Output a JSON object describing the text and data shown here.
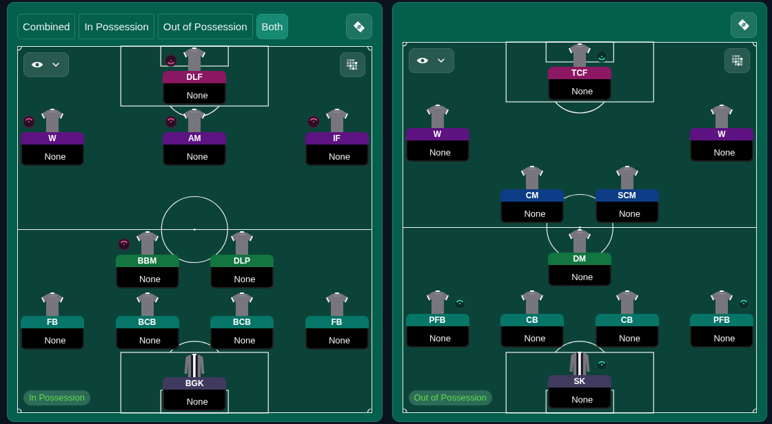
{
  "panels": [
    {
      "kind": "in_possession",
      "tabs": [
        {
          "label": "Combined",
          "selected": false
        },
        {
          "label": "In Possession",
          "selected": false
        },
        {
          "label": "Out of Possession",
          "selected": false
        },
        {
          "label": "Both",
          "selected": true
        }
      ],
      "pitch": {
        "halves": [
          {
            "lines": [
              {
                "centre": {
                  "role": "DLF",
                  "name": "None",
                  "color": "#8c1763",
                  "kind": "outfield",
                  "badge": {
                    "kind": "arc_bottom"
                  }
                }
              },
              {
                "left": {
                  "role": "W",
                  "name": "None",
                  "color": "#5e1382",
                  "kind": "outfield",
                  "badge": {
                    "kind": "arc_top"
                  }
                },
                "centre": {
                  "role": "AM",
                  "name": "None",
                  "color": "#5e1382",
                  "kind": "outfield",
                  "badge": {
                    "kind": "arc_top"
                  }
                },
                "right": {
                  "role": "IF",
                  "name": "None",
                  "color": "#5e1382",
                  "kind": "outfield",
                  "badge": {
                    "kind": "arc_top"
                  }
                }
              }
            ]
          },
          {
            "lines": [
              {
                "centre_left": {
                  "role": "BBM",
                  "name": "None",
                  "color": "#137540",
                  "kind": "outfield",
                  "badge": {
                    "kind": "arc_top"
                  }
                },
                "centre_right": {
                  "role": "DLP",
                  "name": "None",
                  "color": "#137540",
                  "kind": "outfield"
                }
              },
              {
                "left": {
                  "role": "FB",
                  "name": "None",
                  "color": "#077567",
                  "kind": "outfield"
                },
                "centre_left": {
                  "role": "BCB",
                  "name": "None",
                  "color": "#077567",
                  "kind": "outfield"
                },
                "centre_right": {
                  "role": "BCB",
                  "name": "None",
                  "color": "#077567",
                  "kind": "outfield"
                },
                "right": {
                  "role": "FB",
                  "name": "None",
                  "color": "#077567",
                  "kind": "outfield"
                }
              },
              {
                "centre": {
                  "role": "BGK",
                  "name": "None",
                  "color": "#403a5e",
                  "kind": "goalkeeper"
                }
              }
            ]
          }
        ],
        "label": "In Possession"
      }
    },
    {
      "kind": "out_of_possession",
      "pitch": {
        "halves": [
          {
            "lines": [
              {
                "centre": {
                  "role": "TCF",
                  "name": "None",
                  "color": "#8c1763",
                  "kind": "outfield",
                  "badge": {
                    "kind": "arc_bottom"
                  }
                }
              },
              {
                "left": {
                  "role": "W",
                  "name": "None",
                  "color": "#5e1382",
                  "kind": "outfield"
                },
                "right": {
                  "role": "W",
                  "name": "None",
                  "color": "#5e1382",
                  "kind": "outfield"
                }
              },
              {
                "centre_left": {
                  "role": "CM",
                  "name": "None",
                  "color": "#0d3d86",
                  "kind": "outfield"
                },
                "centre_right": {
                  "role": "SCM",
                  "name": "None",
                  "color": "#0d3d86",
                  "kind": "outfield"
                }
              }
            ]
          },
          {
            "lines": [
              {
                "centre": {
                  "role": "DM",
                  "name": "None",
                  "color": "#137540",
                  "kind": "outfield"
                }
              },
              {
                "left": {
                  "role": "PFB",
                  "name": "None",
                  "color": "#077567",
                  "kind": "outfield",
                  "badge": {
                    "kind": "arc_top"
                  }
                },
                "centre_left": {
                  "role": "CB",
                  "name": "None",
                  "color": "#077567",
                  "kind": "outfield"
                },
                "centre_right": {
                  "role": "CB",
                  "name": "None",
                  "color": "#077567",
                  "kind": "outfield"
                },
                "right": {
                  "role": "PFB",
                  "name": "None",
                  "color": "#077567",
                  "kind": "outfield",
                  "badge": {
                    "kind": "arc_top"
                  }
                }
              },
              {
                "centre": {
                  "role": "SK",
                  "name": "None",
                  "color": "#403a5e",
                  "kind": "goalkeeper",
                  "badge": {
                    "kind": "arc_top"
                  }
                }
              }
            ]
          }
        ],
        "label": "Out of Possession"
      }
    }
  ]
}
